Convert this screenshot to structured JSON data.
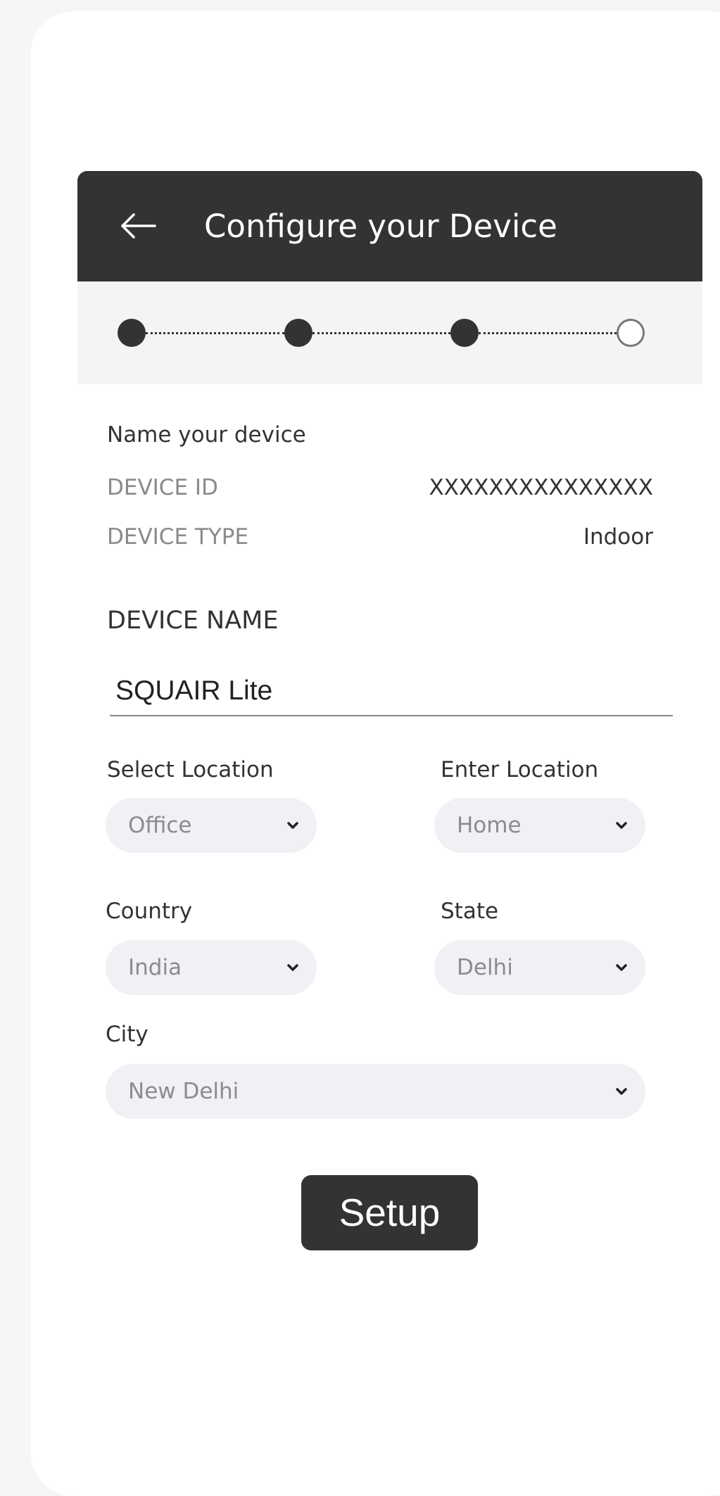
{
  "header": {
    "title": "Configure your Device"
  },
  "stepper": {
    "total_steps": 4,
    "completed_steps": 3
  },
  "device_info": {
    "section_title": "Name your device",
    "id_label": "DEVICE ID",
    "id_value": "XXXXXXXXXXXXXXX",
    "type_label": "DEVICE TYPE",
    "type_value": "Indoor"
  },
  "device_name": {
    "label": "DEVICE NAME",
    "value": "SQUAIR Lite"
  },
  "location": {
    "select_label": "Select Location",
    "select_value": "Office",
    "enter_label": "Enter Location",
    "enter_value": "Home"
  },
  "region": {
    "country_label": "Country",
    "country_value": "India",
    "state_label": "State",
    "state_value": "Delhi",
    "city_label": "City",
    "city_value": "New Delhi"
  },
  "actions": {
    "setup_label": "Setup"
  },
  "colors": {
    "header_bg": "#333333",
    "select_bg": "#f0f0f5",
    "stepper_bg": "#f4f4f6"
  },
  "icons": {
    "back": "left-arrow",
    "dropdown": "chevron-down"
  }
}
